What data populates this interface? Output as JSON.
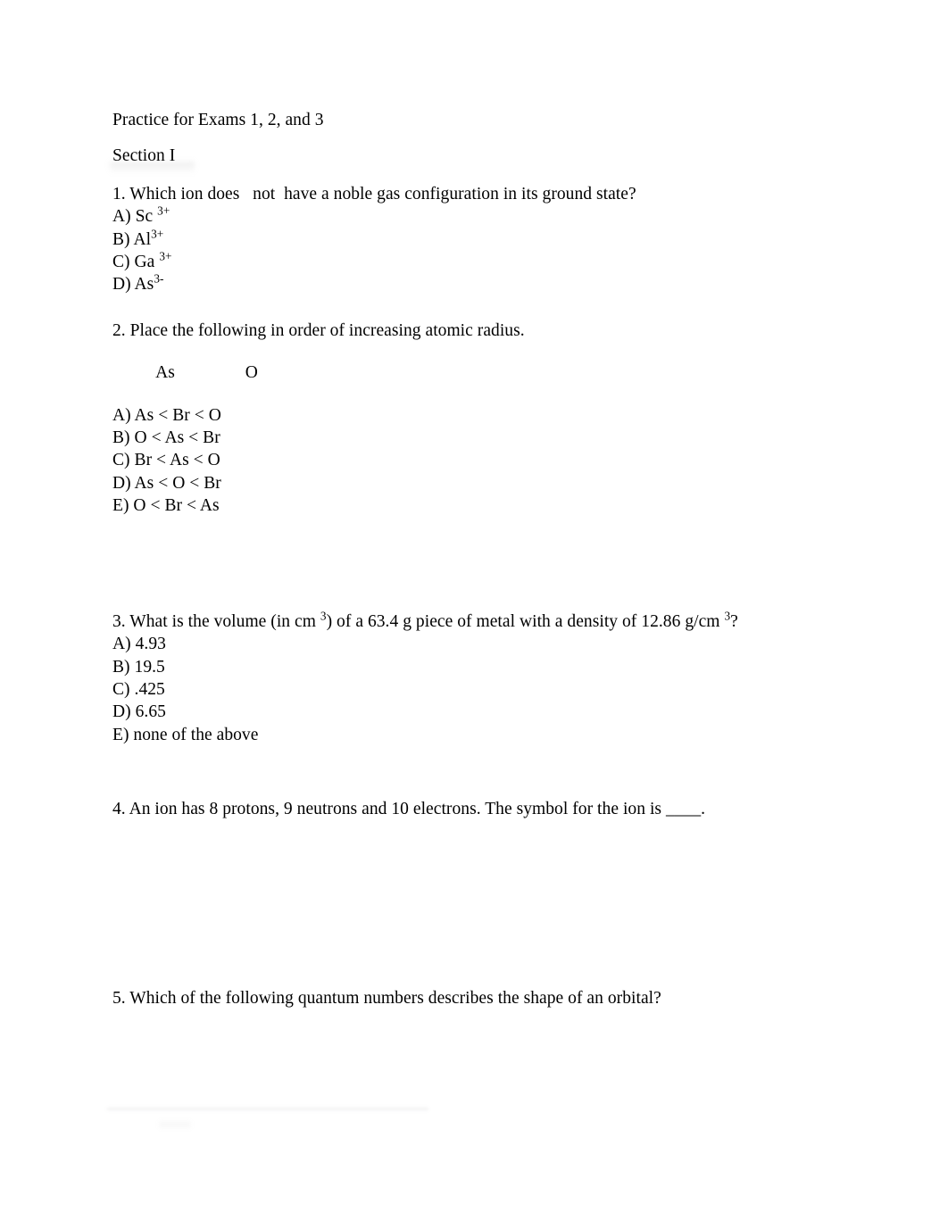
{
  "document": {
    "title": "Practice for Exams 1, 2, and 3",
    "section_heading": "Section I",
    "background_color": "#ffffff",
    "text_color": "#000000",
    "questions": [
      {
        "number": "1.",
        "stem_parts": [
          {
            "text": "1. Which ion does "
          },
          {
            "text": "  not  "
          },
          {
            "text": "have a noble gas configuration in its ground state?"
          }
        ],
        "stem_plain": "1. Which ion does   not  have a noble gas configuration in its ground state?",
        "options": [
          {
            "label": "A)",
            "base": "Sc",
            "space_before_sup": true,
            "sup": "3+",
            "plain": "A) Sc 3+"
          },
          {
            "label": "B)",
            "base": "Al",
            "space_before_sup": false,
            "sup": "3+",
            "plain": "B) Al3+"
          },
          {
            "label": "C)",
            "base": "Ga",
            "space_before_sup": true,
            "sup": "3+",
            "plain": "C) Ga 3+"
          },
          {
            "label": "D)",
            "base": "As",
            "space_before_sup": false,
            "sup": "3-",
            "plain": "D) As3-"
          }
        ]
      },
      {
        "number": "2.",
        "stem_plain": "2. Place the following in order of increasing atomic radius.",
        "inline_row": "          As                O",
        "inline_items": [
          "As",
          "O"
        ],
        "options": [
          {
            "plain": "A) As < Br < O"
          },
          {
            "plain": "B) O < As < Br"
          },
          {
            "plain": "C) Br < As < O"
          },
          {
            "plain": "D) As < O < Br"
          },
          {
            "plain": "E) O < Br < As"
          }
        ]
      },
      {
        "number": "3.",
        "stem_segments": [
          {
            "text": "3. What is the volume (in cm "
          },
          {
            "sup": "3"
          },
          {
            "text": ") of a 63.4 g piece of metal with a density of 12.86 g/cm "
          },
          {
            "sup": "3"
          },
          {
            "text": "?"
          }
        ],
        "stem_plain": "3. What is the volume (in cm 3) of a 63.4 g piece of metal with a density of 12.86 g/cm 3?",
        "options": [
          {
            "plain": "A) 4.93"
          },
          {
            "plain": "B) 19.5"
          },
          {
            "plain": "C) .425"
          },
          {
            "plain": "D) 6.65"
          },
          {
            "plain": "E) none of the above"
          }
        ]
      },
      {
        "number": "4.",
        "stem_plain": "4. An ion has 8 protons, 9 neutrons and 10 electrons. The symbol for the ion is ____.",
        "options": []
      },
      {
        "number": "5.",
        "stem_plain": "5. Which of the following quantum numbers describes the shape of an orbital?",
        "options": []
      }
    ]
  }
}
